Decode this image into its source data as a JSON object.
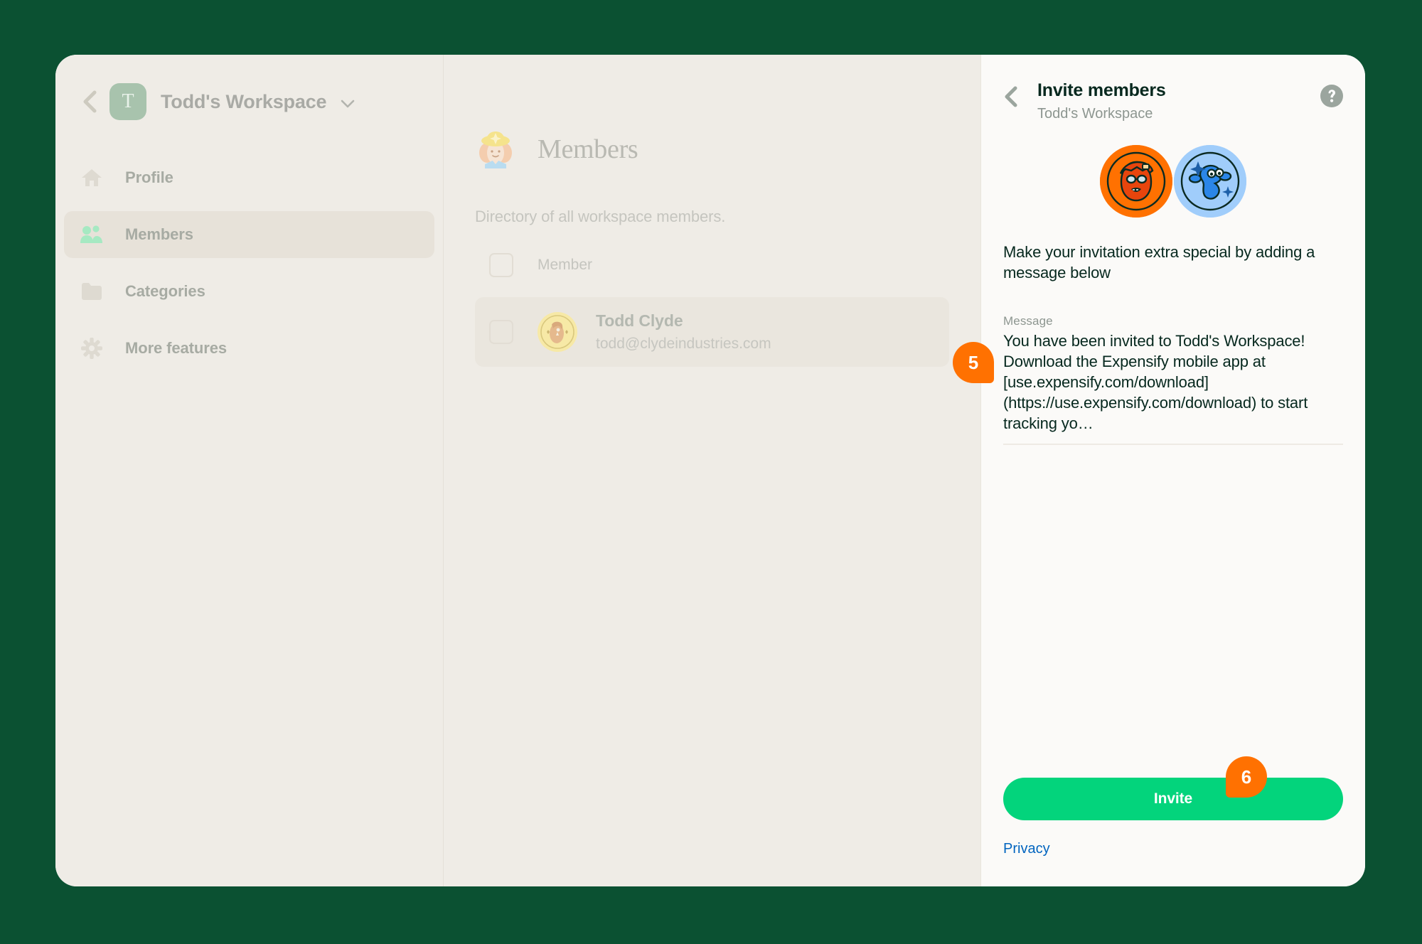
{
  "theme": {
    "page_background": "#0b5132",
    "sidebar_background": "#efece6",
    "panel_background": "#fbfaf8",
    "accent_green": "#03d47c",
    "badge_orange": "#ff7101",
    "link_blue": "#0164bf",
    "title_dark": "#06281e"
  },
  "sidebar": {
    "back_icon": "chevron-left-icon",
    "workspace_avatar_letter": "T",
    "workspace_name": "Todd's Workspace",
    "workspace_caret_icon": "chevron-down-icon",
    "items": [
      {
        "label": "Profile",
        "icon": "home-icon",
        "active": false
      },
      {
        "label": "Members",
        "icon": "people-icon",
        "active": true
      },
      {
        "label": "Categories",
        "icon": "folder-icon",
        "active": false
      },
      {
        "label": "More features",
        "icon": "gear-icon",
        "active": false
      }
    ]
  },
  "main": {
    "header_icon": "cowboy-member-illustration",
    "title": "Members",
    "subtitle": "Directory of all workspace members.",
    "list_header": {
      "checkbox_checked": false,
      "column_label": "Member"
    },
    "rows": [
      {
        "checkbox_checked": false,
        "avatar": "todd-avatar-icon",
        "name": "Todd Clyde",
        "email": "todd@clydeindustries.com"
      }
    ]
  },
  "right_panel": {
    "back_icon": "chevron-left-icon",
    "title": "Invite members",
    "subtitle": "Todd's Workspace",
    "help_icon": "question-mark-circle-icon",
    "illustration": {
      "left_coin_icon": "orange-person-coin-icon",
      "right_coin_icon": "blue-creature-coin-icon"
    },
    "blurb": "Make your invitation extra special by adding a message below",
    "message_field": {
      "label": "Message",
      "value": "You have been invited to Todd's Workspace! Download the Expensify mobile app at [use.expensify.com/download](https://use.expensify.com/download) to start tracking yo…"
    },
    "invite_button_label": "Invite",
    "privacy_link_label": "Privacy"
  },
  "annotations": {
    "badges": [
      {
        "number": "5",
        "target": "message-field"
      },
      {
        "number": "6",
        "target": "invite-button"
      }
    ]
  }
}
